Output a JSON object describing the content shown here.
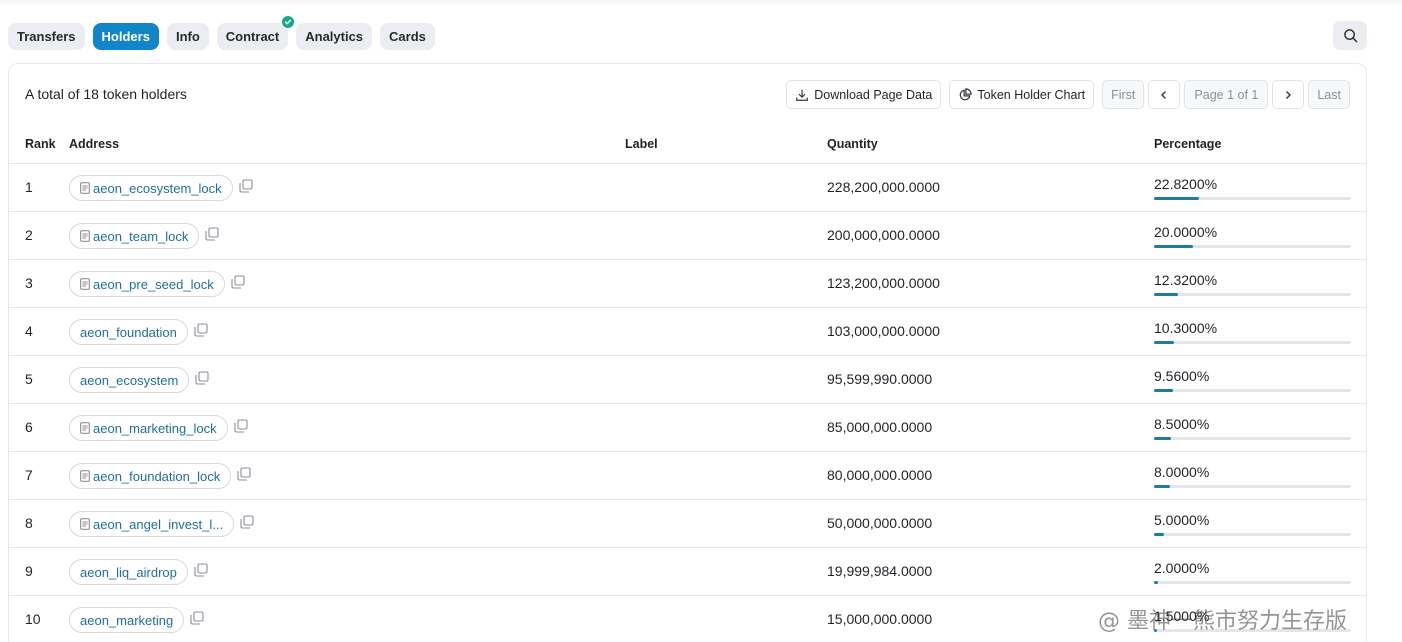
{
  "tabs": [
    {
      "label": "Transfers",
      "active": false
    },
    {
      "label": "Holders",
      "active": true
    },
    {
      "label": "Info",
      "active": false
    },
    {
      "label": "Contract",
      "active": false,
      "verified": true
    },
    {
      "label": "Analytics",
      "active": false
    },
    {
      "label": "Cards",
      "active": false
    }
  ],
  "colors": {
    "accent": "#1185c8",
    "verified": "#17a884",
    "bar_fill": "#17809e",
    "link": "#1f6f9c"
  },
  "summary": "A total of 18 token holders",
  "toolbar": {
    "download_label": "Download Page Data",
    "chart_label": "Token Holder Chart",
    "first_label": "First",
    "page_label": "Page 1 of 1",
    "last_label": "Last"
  },
  "columns": {
    "rank": "Rank",
    "address": "Address",
    "label": "Label",
    "quantity": "Quantity",
    "percentage": "Percentage"
  },
  "holders": [
    {
      "rank": "1",
      "address": "aeon_ecosystem_lock",
      "contract": true,
      "quantity": "228,200,000.0000",
      "percentage": "22.8200%",
      "fraction": 0.2282
    },
    {
      "rank": "2",
      "address": "aeon_team_lock",
      "contract": true,
      "quantity": "200,000,000.0000",
      "percentage": "20.0000%",
      "fraction": 0.2
    },
    {
      "rank": "3",
      "address": "aeon_pre_seed_lock",
      "contract": true,
      "quantity": "123,200,000.0000",
      "percentage": "12.3200%",
      "fraction": 0.1232
    },
    {
      "rank": "4",
      "address": "aeon_foundation",
      "contract": false,
      "quantity": "103,000,000.0000",
      "percentage": "10.3000%",
      "fraction": 0.103
    },
    {
      "rank": "5",
      "address": "aeon_ecosystem",
      "contract": false,
      "quantity": "95,599,990.0000",
      "percentage": "9.5600%",
      "fraction": 0.0956
    },
    {
      "rank": "6",
      "address": "aeon_marketing_lock",
      "contract": true,
      "quantity": "85,000,000.0000",
      "percentage": "8.5000%",
      "fraction": 0.085
    },
    {
      "rank": "7",
      "address": "aeon_foundation_lock",
      "contract": true,
      "quantity": "80,000,000.0000",
      "percentage": "8.0000%",
      "fraction": 0.08
    },
    {
      "rank": "8",
      "address": "aeon_angel_invest_l...",
      "contract": true,
      "quantity": "50,000,000.0000",
      "percentage": "5.0000%",
      "fraction": 0.05
    },
    {
      "rank": "9",
      "address": "aeon_liq_airdrop",
      "contract": false,
      "quantity": "19,999,984.0000",
      "percentage": "2.0000%",
      "fraction": 0.02
    },
    {
      "rank": "10",
      "address": "aeon_marketing",
      "contract": false,
      "quantity": "15,000,000.0000",
      "percentage": "1.5000%",
      "fraction": 0.015
    }
  ],
  "watermark": "@ 墨神一熊市努力生存版",
  "icons": {
    "search": "search-icon",
    "download": "download-icon",
    "chart": "pie-chart-icon",
    "copy": "copy-icon",
    "contract": "document-icon",
    "check": "check-icon"
  }
}
